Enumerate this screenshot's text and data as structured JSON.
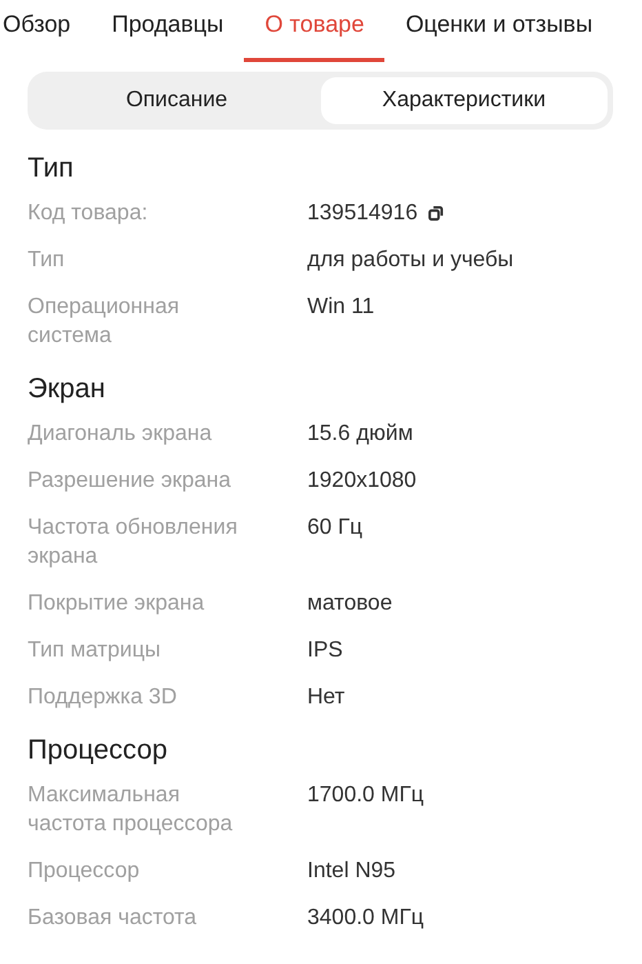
{
  "tabs": [
    {
      "label": "Обзор",
      "selected": false
    },
    {
      "label": "Продавцы",
      "selected": false
    },
    {
      "label": "О товаре",
      "selected": true
    },
    {
      "label": "Оценки и отзывы",
      "selected": false
    }
  ],
  "segments": [
    {
      "label": "Описание",
      "selected": false
    },
    {
      "label": "Характеристики",
      "selected": true
    }
  ],
  "sections": [
    {
      "title": "Тип",
      "rows": [
        {
          "kind": "copyable",
          "label": "Код товара:",
          "value": "139514916"
        },
        {
          "kind": "plain",
          "label": "Тип",
          "value": "для работы и учебы"
        },
        {
          "kind": "plain",
          "label": "Операционная система",
          "value": "Win 11"
        }
      ]
    },
    {
      "title": "Экран",
      "rows": [
        {
          "kind": "plain",
          "label": "Диагональ экрана",
          "value": "15.6 дюйм"
        },
        {
          "kind": "plain",
          "label": "Разрешение экрана",
          "value": "1920x1080"
        },
        {
          "kind": "plain",
          "label": "Частота обновления экрана",
          "value": "60 Гц"
        },
        {
          "kind": "plain",
          "label": "Покрытие экрана",
          "value": "матовое"
        },
        {
          "kind": "plain",
          "label": "Тип матрицы",
          "value": "IPS"
        },
        {
          "kind": "plain",
          "label": "Поддержка 3D",
          "value": "Нет"
        }
      ]
    },
    {
      "title": "Процессор",
      "rows": [
        {
          "kind": "plain",
          "label": "Максимальная частота процессора",
          "value": "1700.0 МГц"
        },
        {
          "kind": "plain",
          "label": "Процессор",
          "value": "Intel N95"
        },
        {
          "kind": "plain",
          "label": "Базовая частота",
          "value": "3400.0 МГц"
        }
      ]
    }
  ]
}
